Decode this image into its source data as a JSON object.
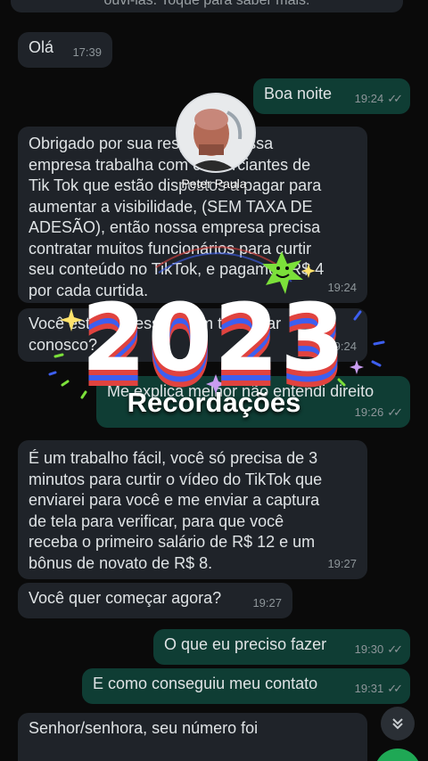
{
  "header_text": "ouvi-las. Toque para saber mais.",
  "messages": [
    {
      "dir": "in",
      "text": "Olá",
      "time": "17:39",
      "ticks": false
    },
    {
      "dir": "out",
      "text": "Boa noite",
      "time": "19:24",
      "ticks": true
    },
    {
      "dir": "in",
      "text": "Obrigado por sua resposta. Nossa\nempresa trabalha com comerciantes de\nTik Tok que estão dispostos a pagar para\naumentar a visibilidade, (SEM TAXA DE\nADESÃO), então nossa empresa precisa\ncontratar muitos funcionários para curtir\nseu conteúdo no TikTok, e pagamos R$ 4\npor cada curtida.",
      "time": "19:24",
      "ticks": false
    },
    {
      "dir": "in",
      "text": "Você está interessado em trabalhar\nconosco?",
      "time": "19:24",
      "ticks": false
    },
    {
      "dir": "out",
      "text": "Me explica melhor não entendi direito",
      "time": "19:26",
      "ticks": true
    },
    {
      "dir": "in",
      "text": "É um trabalho fácil, você só precisa de 3\nminutos para curtir o vídeo do TikTok que\nenviarei para você e me enviar a captura\nde tela para verificar, para que você\nreceba o primeiro salário de R$ 12 e um\nbônus de novato de R$ 8.",
      "time": "19:27",
      "ticks": false
    },
    {
      "dir": "in",
      "text": "Você quer começar agora?",
      "time": "19:27",
      "ticks": false
    },
    {
      "dir": "out",
      "text": "O que eu preciso fazer",
      "time": "19:30",
      "ticks": true
    },
    {
      "dir": "out",
      "text": "E como conseguiu meu contato",
      "time": "19:31",
      "ticks": true
    },
    {
      "dir": "in",
      "text": "Senhor/senhora, seu número foi",
      "time": "",
      "ticks": false
    }
  ],
  "overlay": {
    "profile_name": "Peter Paula",
    "year": "2023",
    "subtitle": "Recordações",
    "colors": {
      "red": "#e0433f",
      "blue": "#3d5ff0",
      "green": "#7be03a",
      "star": "#ffe36b"
    }
  },
  "scroll_icon": "chevrons-down-icon",
  "ticks_icon": "double-check-icon"
}
